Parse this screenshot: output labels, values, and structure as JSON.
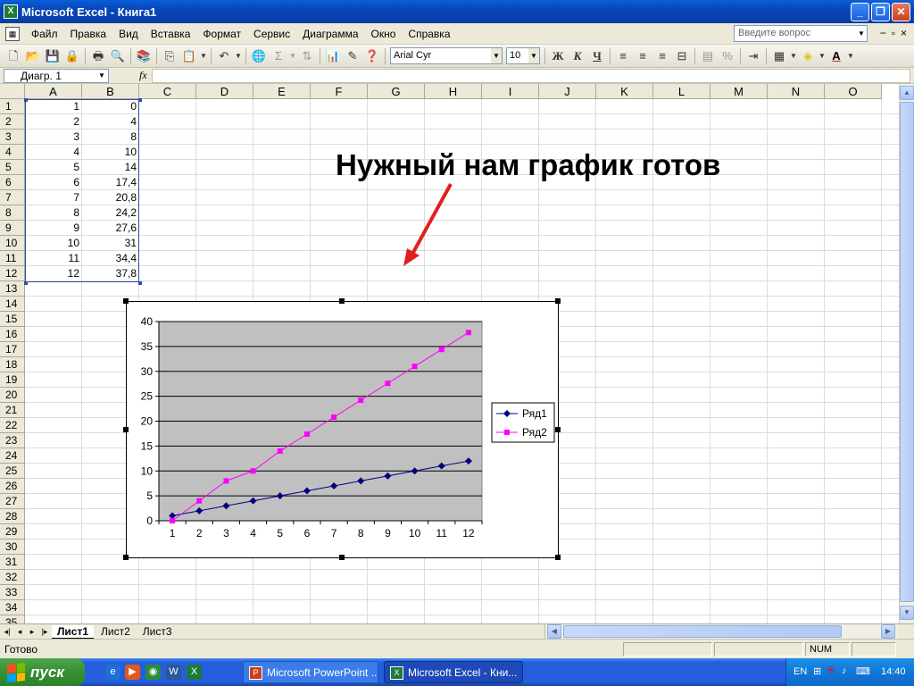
{
  "window": {
    "title": "Microsoft Excel - Книга1",
    "app_icon": "excel-icon",
    "controls": [
      "minimize-icon",
      "restore-icon",
      "close-icon"
    ]
  },
  "menu": {
    "items": [
      "Файл",
      "Правка",
      "Вид",
      "Вставка",
      "Формат",
      "Сервис",
      "Диаграмма",
      "Окно",
      "Справка"
    ],
    "help_placeholder": "Введите вопрос",
    "doc_controls": [
      "−",
      "▫",
      "×"
    ]
  },
  "toolbar": {
    "font_name": "Arial Cyr",
    "font_size": "10",
    "bold": "Ж",
    "italic": "К",
    "underline": "Ч",
    "percent": "%",
    "font_color_glyph": "A"
  },
  "formula_bar": {
    "name_box": "Диагр. 1",
    "fx": "fx"
  },
  "grid": {
    "columns": [
      "A",
      "B",
      "C",
      "D",
      "E",
      "F",
      "G",
      "H",
      "I",
      "J",
      "K",
      "L",
      "M",
      "N",
      "O"
    ],
    "rows": [
      "1",
      "2",
      "3",
      "4",
      "5",
      "6",
      "7",
      "8",
      "9",
      "10",
      "11",
      "12",
      "13",
      "14",
      "15",
      "16",
      "17",
      "18",
      "19",
      "20",
      "21",
      "22",
      "23",
      "24",
      "25",
      "26",
      "27",
      "28",
      "29",
      "30",
      "31",
      "32",
      "33",
      "34",
      "35"
    ],
    "col_a": [
      "1",
      "2",
      "3",
      "4",
      "5",
      "6",
      "7",
      "8",
      "9",
      "10",
      "11",
      "12"
    ],
    "col_b": [
      "0",
      "4",
      "8",
      "10",
      "14",
      "17,4",
      "20,8",
      "24,2",
      "27,6",
      "31",
      "34,4",
      "37,8"
    ]
  },
  "annotation": {
    "text": "Нужный нам график готов",
    "arrow_color": "#e0201f"
  },
  "chart_data": {
    "type": "line",
    "categories": [
      "1",
      "2",
      "3",
      "4",
      "5",
      "6",
      "7",
      "8",
      "9",
      "10",
      "11",
      "12"
    ],
    "series": [
      {
        "name": "Ряд1",
        "values": [
          1,
          2,
          3,
          4,
          5,
          6,
          7,
          8,
          9,
          10,
          11,
          12
        ],
        "color": "#000080",
        "marker": "diamond"
      },
      {
        "name": "Ряд2",
        "values": [
          0,
          4,
          8,
          10,
          14,
          17.4,
          20.8,
          24.2,
          27.6,
          31,
          34.4,
          37.8
        ],
        "color": "#ff00ff",
        "marker": "square"
      }
    ],
    "ylim": [
      0,
      40
    ],
    "yticks": [
      0,
      5,
      10,
      15,
      20,
      25,
      30,
      35,
      40
    ],
    "grid": true,
    "plot_background": "#c0c0c0",
    "legend": "right"
  },
  "sheets": {
    "tabs": [
      "Лист1",
      "Лист2",
      "Лист3"
    ],
    "active": "Лист1",
    "nav": [
      "◂|",
      "◂",
      "▸",
      "|▸"
    ]
  },
  "status": {
    "text": "Готово",
    "num": "NUM"
  },
  "taskbar": {
    "start": "пуск",
    "quicklaunch": [
      "ie-icon",
      "media-icon",
      "chrome-icon",
      "word-icon",
      "excel-icon"
    ],
    "tasks": [
      {
        "label": "Microsoft PowerPoint ...",
        "icon": "P",
        "active": false
      },
      {
        "label": "Microsoft Excel - Кни...",
        "icon": "X",
        "active": true
      }
    ],
    "lang": "EN",
    "time": "14:40"
  }
}
